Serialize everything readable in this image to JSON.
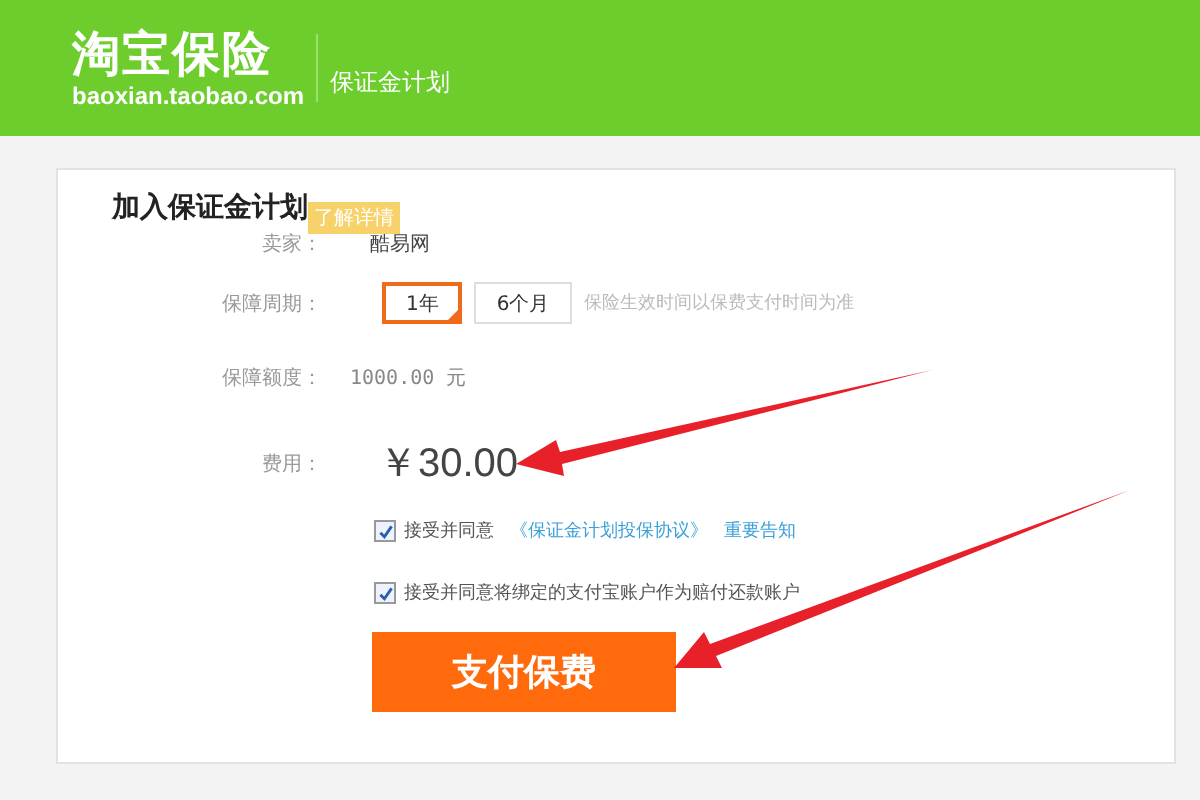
{
  "header": {
    "logo_title": "淘宝保险",
    "logo_domain": "baoxian.taobao.com",
    "section": "保证金计划"
  },
  "card": {
    "title": "加入保证金计划",
    "tip": "了解详情"
  },
  "seller": {
    "label": "卖家：",
    "value": "酷易网"
  },
  "period": {
    "label": "保障周期：",
    "options": [
      {
        "label": "1年",
        "selected": true
      },
      {
        "label": "6个月",
        "selected": false
      }
    ],
    "hint": "保险生效时间以保费支付时间为准"
  },
  "coverage": {
    "label": "保障额度：",
    "value": "1000.00 元"
  },
  "fee": {
    "label": "费用：",
    "value": "￥30.00"
  },
  "agreements": [
    {
      "checked": true,
      "text": "接受并同意",
      "links": [
        "《保证金计划投保协议》",
        "重要告知"
      ]
    },
    {
      "checked": true,
      "text": "接受并同意将绑定的支付宝账户作为赔付还款账户"
    }
  ],
  "pay_button": "支付保费"
}
